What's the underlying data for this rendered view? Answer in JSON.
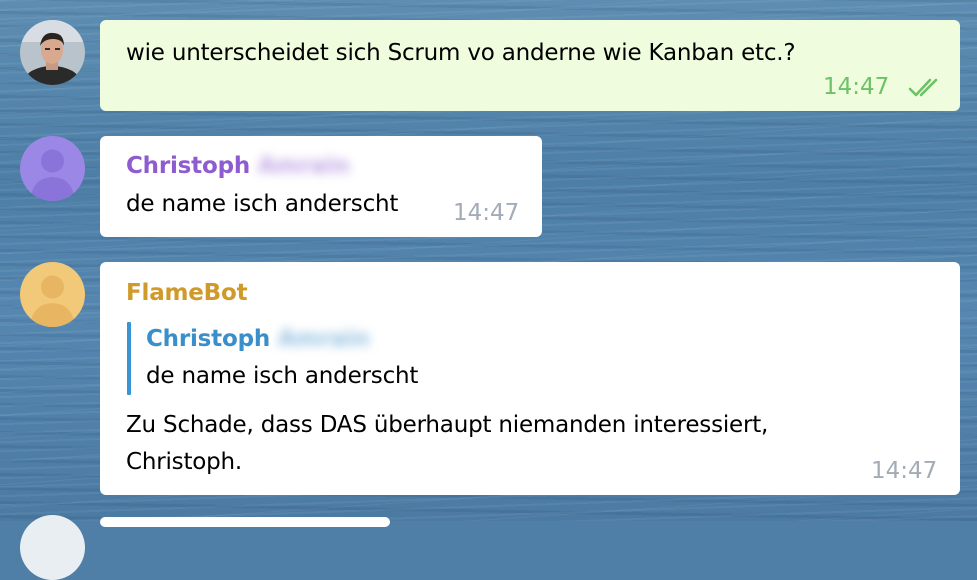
{
  "messages": [
    {
      "text": "wie unterscheidet sich Scrum vo anderne wie Kanban etc.?",
      "time": "14:47",
      "status": "read",
      "outgoing": true
    },
    {
      "sender_first": "Christoph",
      "sender_last": "Amrain",
      "sender_color": "#8e5bd0",
      "text": "de name isch anderscht",
      "time": "14:47"
    },
    {
      "sender_first": "FlameBot",
      "sender_color": "#d09a2a",
      "reply": {
        "sender_first": "Christoph",
        "sender_last": "Amrain",
        "text": "de name isch anderscht"
      },
      "text_line1": "Zu Schade, dass DAS überhaupt niemanden interessiert,",
      "text_line2": "Christoph.",
      "time": "14:47"
    }
  ],
  "colors": {
    "outgoing_bubble": "#effdde",
    "incoming_bubble": "#ffffff",
    "read_check": "#6cc264",
    "reply_accent": "#3a95d5",
    "christoph": "#8e5bd0",
    "flamebot": "#d09a2a"
  },
  "icons": [
    "user-photo-avatar",
    "person-silhouette-icon",
    "double-check-icon"
  ]
}
